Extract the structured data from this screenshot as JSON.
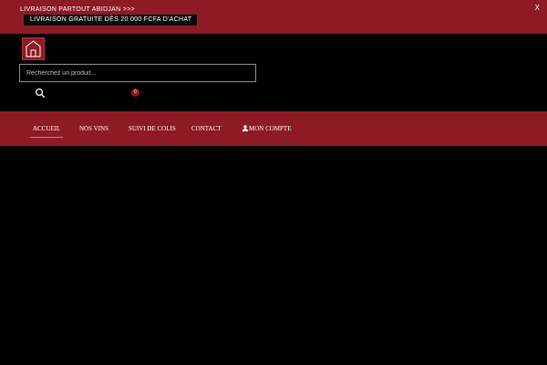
{
  "announcement": {
    "line1": "LIVRAISON PARTOUT ABIDJAN >>>",
    "line2": "LIVRAISON GRATUITE DÈS 20 000 FCFA D'ACHAT",
    "close": "X"
  },
  "header": {
    "logo_icon": "house-icon",
    "search_placeholder": "Recherchez un produit...",
    "search_icon": "search-icon",
    "cart_count": "0"
  },
  "nav": {
    "items": [
      {
        "label": "ACCUEIL",
        "active": true
      },
      {
        "label": "NOS VINS"
      },
      {
        "label": "SUIVI DE COLIS"
      },
      {
        "label": "CONTACT"
      },
      {
        "label": "MON COMPTE",
        "icon": "user-icon"
      }
    ]
  },
  "colors": {
    "brand": "#8e1a25",
    "background": "#000000",
    "active_underline": "#3fb3c8"
  }
}
